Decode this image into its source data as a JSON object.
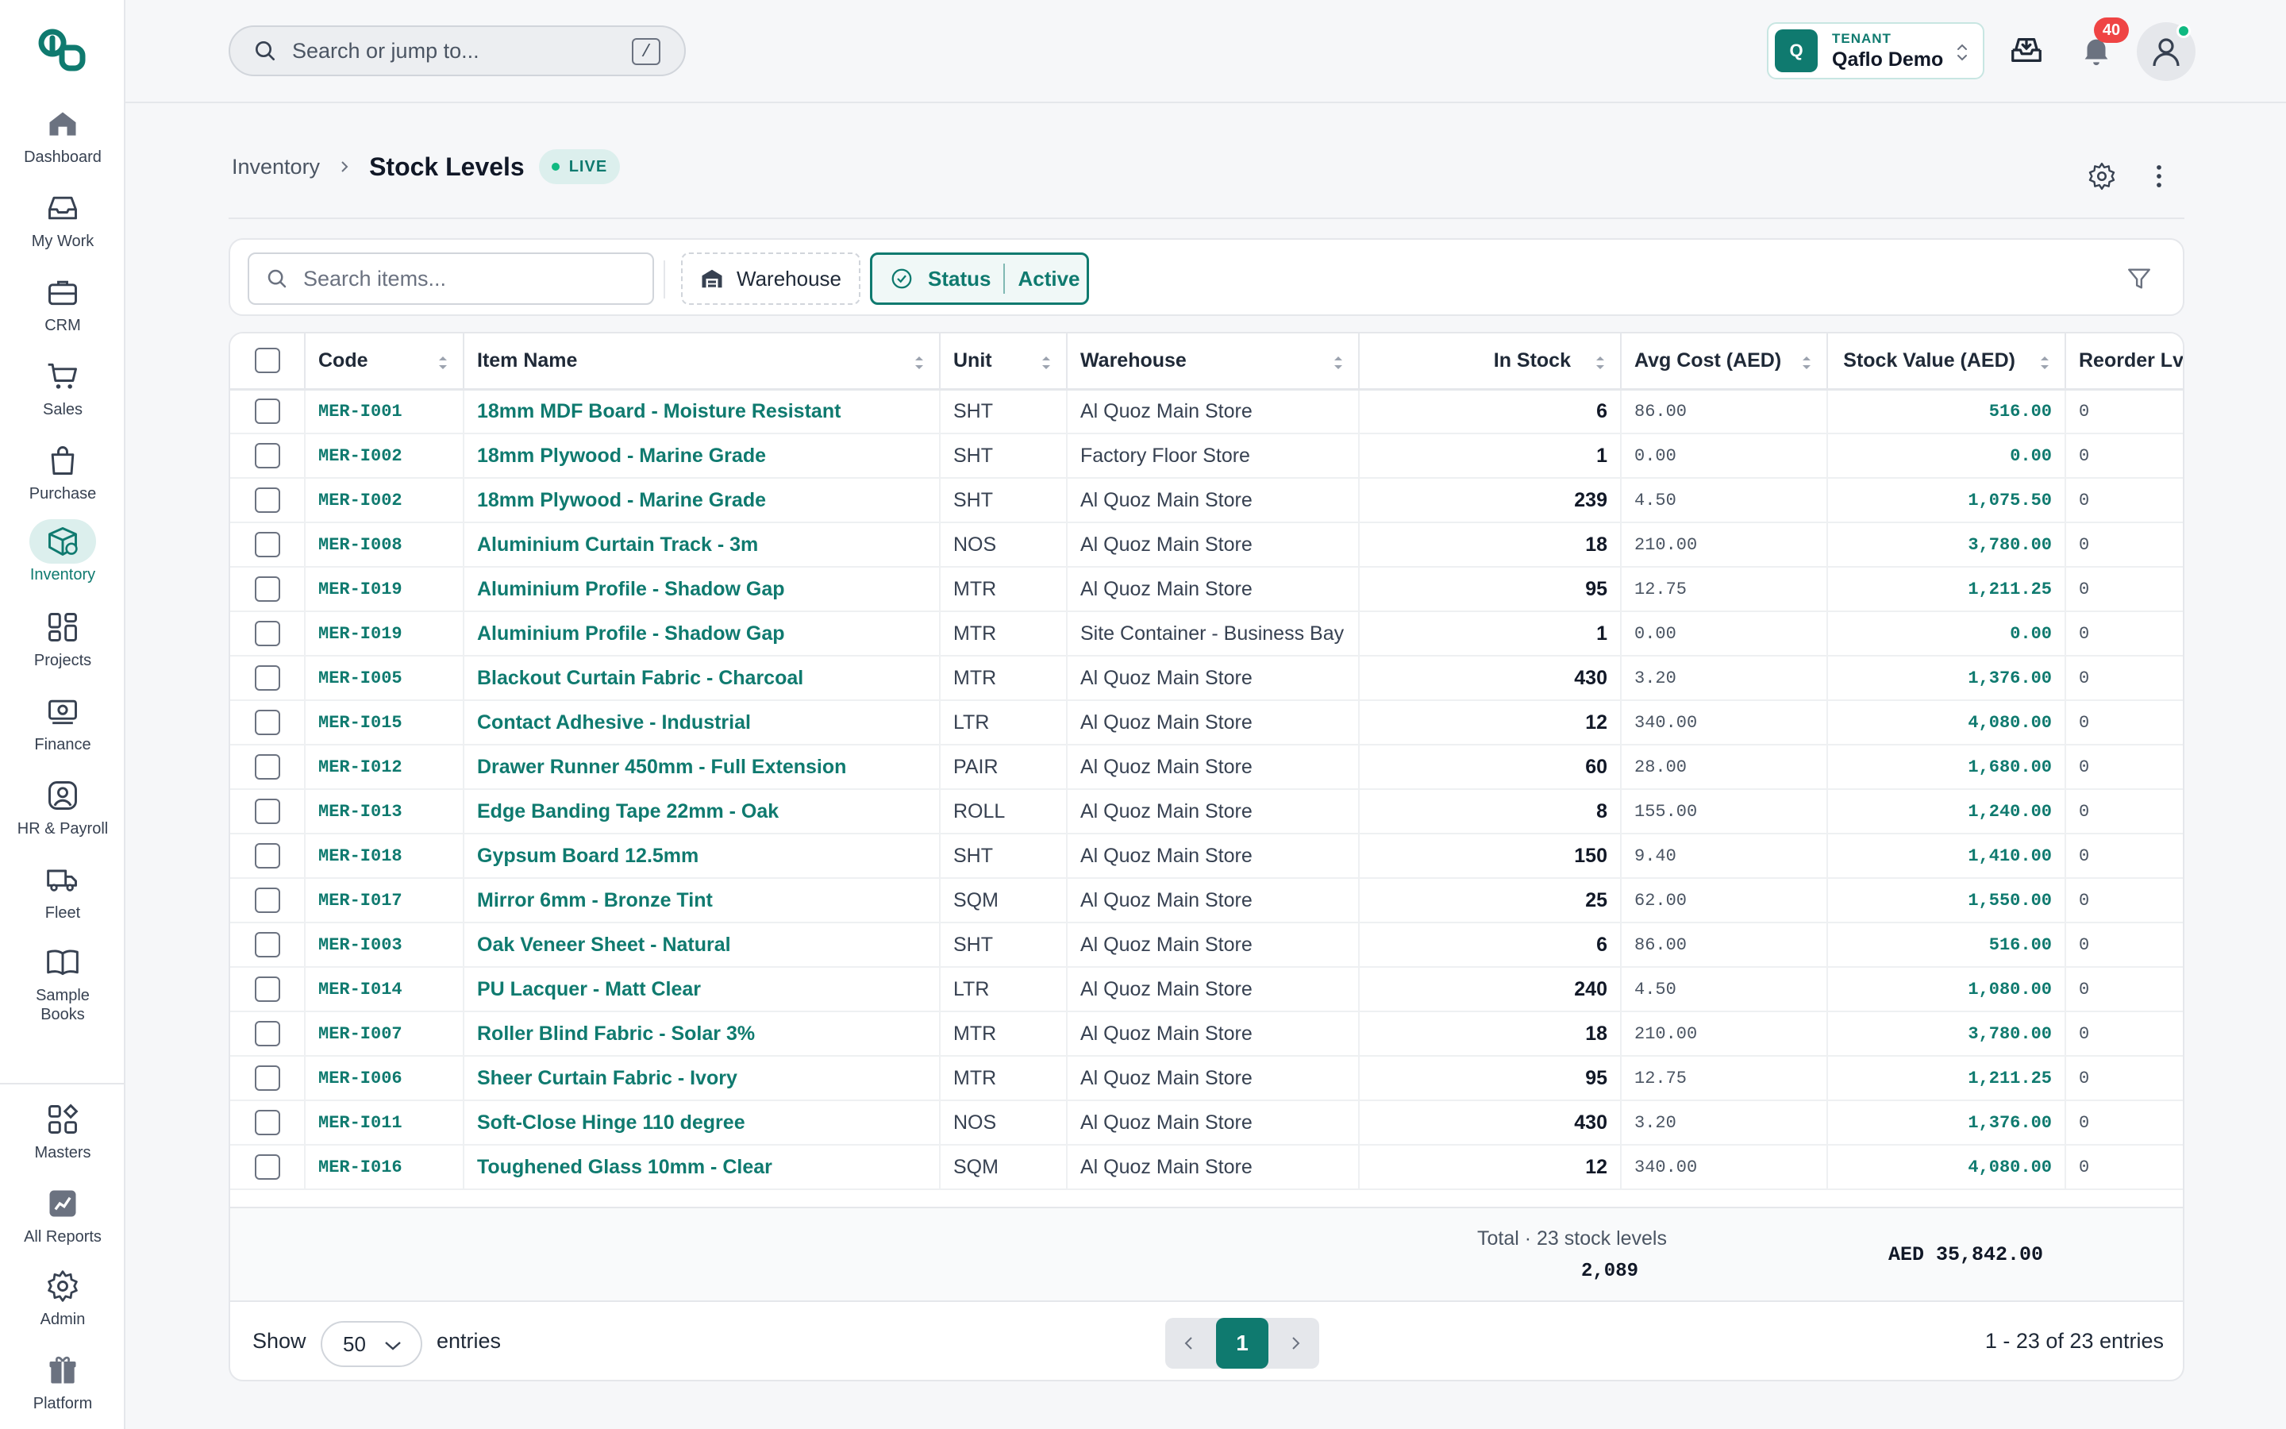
{
  "sidebar": {
    "items": [
      {
        "label": "Dashboard",
        "icon": "home-icon"
      },
      {
        "label": "My Work",
        "icon": "inbox-icon"
      },
      {
        "label": "CRM",
        "icon": "briefcase-icon"
      },
      {
        "label": "Sales",
        "icon": "cart-icon"
      },
      {
        "label": "Purchase",
        "icon": "bag-icon"
      },
      {
        "label": "Inventory",
        "icon": "box-icon"
      },
      {
        "label": "Projects",
        "icon": "grid-icon"
      },
      {
        "label": "Finance",
        "icon": "cash-icon"
      },
      {
        "label": "HR & Payroll",
        "icon": "user-icon"
      },
      {
        "label": "Fleet",
        "icon": "truck-icon"
      },
      {
        "label": "Sample Books",
        "icon": "book-icon"
      }
    ],
    "bottom": [
      {
        "label": "Masters",
        "icon": "apps-icon"
      },
      {
        "label": "All Reports",
        "icon": "chart-icon"
      },
      {
        "label": "Admin",
        "icon": "gear-icon"
      },
      {
        "label": "Platform",
        "icon": "gift-icon"
      }
    ],
    "active": "Inventory"
  },
  "topbar": {
    "search_placeholder": "Search or jump to...",
    "search_shortcut": "/",
    "tenant_caption": "TENANT",
    "tenant_name": "Qaflo Demo",
    "tenant_badge": "Q",
    "notifications_count": "40"
  },
  "header": {
    "breadcrumb_parent": "Inventory",
    "title": "Stock Levels",
    "live_badge": "LIVE"
  },
  "filters": {
    "search_placeholder": "Search items...",
    "warehouse_label": "Warehouse",
    "status_label": "Status",
    "status_value": "Active"
  },
  "table": {
    "columns": [
      "Code",
      "Item Name",
      "Unit",
      "Warehouse",
      "In Stock",
      "Avg Cost (AED)",
      "Stock Value (AED)",
      "Reorder Lvl"
    ],
    "rows": [
      [
        "MER-I001",
        "18mm MDF Board - Moisture Resistant",
        "SHT",
        "Al Quoz Main Store",
        "6",
        "86.00",
        "516.00",
        "0"
      ],
      [
        "MER-I002",
        "18mm Plywood - Marine Grade",
        "SHT",
        "Factory Floor Store",
        "1",
        "0.00",
        "0.00",
        "0"
      ],
      [
        "MER-I002",
        "18mm Plywood - Marine Grade",
        "SHT",
        "Al Quoz Main Store",
        "239",
        "4.50",
        "1,075.50",
        "0"
      ],
      [
        "MER-I008",
        "Aluminium Curtain Track - 3m",
        "NOS",
        "Al Quoz Main Store",
        "18",
        "210.00",
        "3,780.00",
        "0"
      ],
      [
        "MER-I019",
        "Aluminium Profile - Shadow Gap",
        "MTR",
        "Al Quoz Main Store",
        "95",
        "12.75",
        "1,211.25",
        "0"
      ],
      [
        "MER-I019",
        "Aluminium Profile - Shadow Gap",
        "MTR",
        "Site Container - Business Bay",
        "1",
        "0.00",
        "0.00",
        "0"
      ],
      [
        "MER-I005",
        "Blackout Curtain Fabric - Charcoal",
        "MTR",
        "Al Quoz Main Store",
        "430",
        "3.20",
        "1,376.00",
        "0"
      ],
      [
        "MER-I015",
        "Contact Adhesive - Industrial",
        "LTR",
        "Al Quoz Main Store",
        "12",
        "340.00",
        "4,080.00",
        "0"
      ],
      [
        "MER-I012",
        "Drawer Runner 450mm - Full Extension",
        "PAIR",
        "Al Quoz Main Store",
        "60",
        "28.00",
        "1,680.00",
        "0"
      ],
      [
        "MER-I013",
        "Edge Banding Tape 22mm - Oak",
        "ROLL",
        "Al Quoz Main Store",
        "8",
        "155.00",
        "1,240.00",
        "0"
      ],
      [
        "MER-I018",
        "Gypsum Board 12.5mm",
        "SHT",
        "Al Quoz Main Store",
        "150",
        "9.40",
        "1,410.00",
        "0"
      ],
      [
        "MER-I017",
        "Mirror 6mm - Bronze Tint",
        "SQM",
        "Al Quoz Main Store",
        "25",
        "62.00",
        "1,550.00",
        "0"
      ],
      [
        "MER-I003",
        "Oak Veneer Sheet - Natural",
        "SHT",
        "Al Quoz Main Store",
        "6",
        "86.00",
        "516.00",
        "0"
      ],
      [
        "MER-I014",
        "PU Lacquer - Matt Clear",
        "LTR",
        "Al Quoz Main Store",
        "240",
        "4.50",
        "1,080.00",
        "0"
      ],
      [
        "MER-I007",
        "Roller Blind Fabric - Solar 3%",
        "MTR",
        "Al Quoz Main Store",
        "18",
        "210.00",
        "3,780.00",
        "0"
      ],
      [
        "MER-I006",
        "Sheer Curtain Fabric - Ivory",
        "MTR",
        "Al Quoz Main Store",
        "95",
        "12.75",
        "1,211.25",
        "0"
      ],
      [
        "MER-I011",
        "Soft-Close Hinge 110 degree",
        "NOS",
        "Al Quoz Main Store",
        "430",
        "3.20",
        "1,376.00",
        "0"
      ],
      [
        "MER-I016",
        "Toughened Glass 10mm - Clear",
        "SQM",
        "Al Quoz Main Store",
        "12",
        "340.00",
        "4,080.00",
        "0"
      ]
    ],
    "totals_label": "Total · 23 stock levels",
    "totals_in_stock": "2,089",
    "totals_value": "AED 35,842.00"
  },
  "pagination": {
    "show_label": "Show",
    "page_size": "50",
    "entries_label": "entries",
    "current_page": "1",
    "range_text": "1 - 23 of 23 entries"
  },
  "colors": {
    "accent": "#0f7a6f",
    "accent_light": "#dcefed",
    "badge_red": "#ef4444",
    "online_green": "#10b981"
  }
}
